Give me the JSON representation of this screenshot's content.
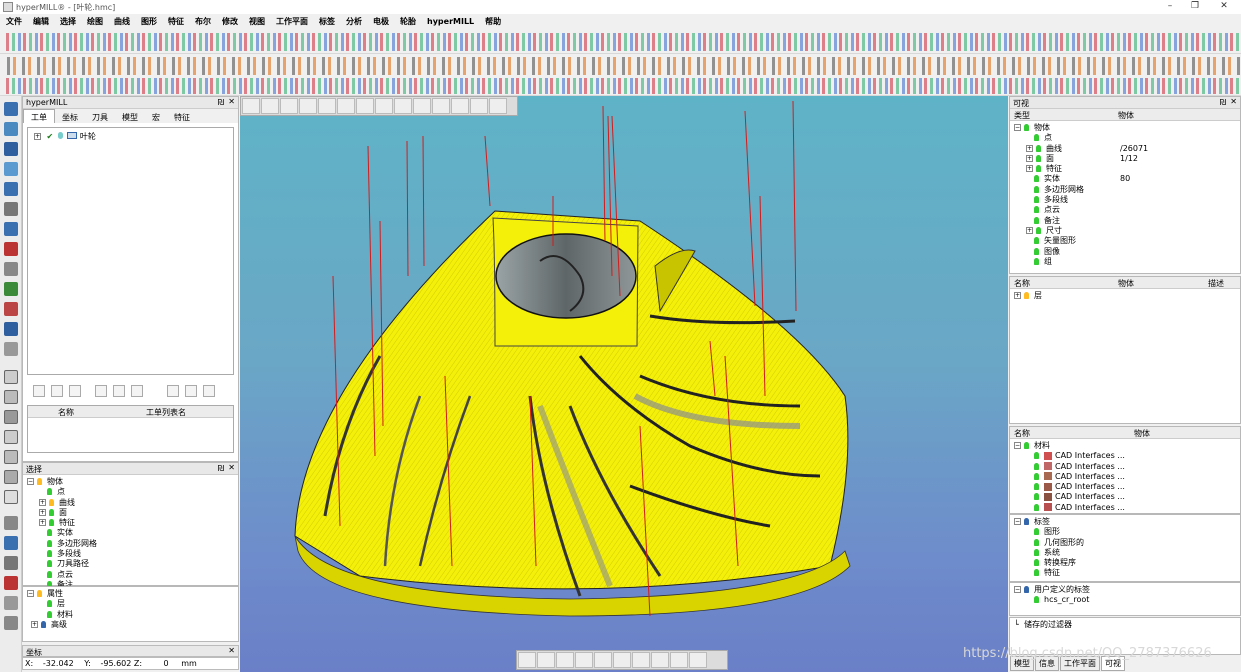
{
  "window": {
    "title": "hyperMILL® - [叶轮.hmc]",
    "min": "–",
    "max": "❐",
    "close": "✕"
  },
  "menu": [
    "文件",
    "编辑",
    "选择",
    "绘图",
    "曲线",
    "图形",
    "特征",
    "布尔",
    "修改",
    "视图",
    "工作平面",
    "标签",
    "分析",
    "电极",
    "轮胎",
    "hyperMILL",
    "帮助"
  ],
  "hypermill_panel": {
    "title": "hyperMILL",
    "pin": "₪",
    "close": "✕",
    "tabs": [
      "工单",
      "坐标",
      "刀具",
      "模型",
      "宏",
      "特征"
    ],
    "active_tab": "工单",
    "tree_root": "叶轮",
    "list_columns": [
      "名称",
      "工单列表名"
    ]
  },
  "select_panel": {
    "title": "选择",
    "items": [
      "物体",
      "点",
      "曲线",
      "面",
      "特征",
      "实体",
      "多边形网格",
      "多段线",
      "刀具路径",
      "点云",
      "备注"
    ]
  },
  "attr_panel": {
    "items": [
      "属性",
      "层",
      "材料",
      "高级"
    ]
  },
  "coords": {
    "title": "坐标",
    "x_label": "X:",
    "x_value": "-32.042",
    "y_label": "Y:",
    "y_value": "-95.602",
    "z_label": "Z:",
    "z_value": "0",
    "unit": "mm"
  },
  "visible_panel": {
    "title": "可视",
    "columns": [
      "类型",
      "物体"
    ],
    "rows": [
      {
        "label": "物体",
        "value": ""
      },
      {
        "label": "点",
        "value": ""
      },
      {
        "label": "曲线",
        "value": "/26071"
      },
      {
        "label": "面",
        "value": "1/12"
      },
      {
        "label": "特征",
        "value": ""
      },
      {
        "label": "实体",
        "value": "80"
      },
      {
        "label": "多边形网格",
        "value": ""
      },
      {
        "label": "多段线",
        "value": ""
      },
      {
        "label": "点云",
        "value": ""
      },
      {
        "label": "备注",
        "value": ""
      },
      {
        "label": "尺寸",
        "value": ""
      },
      {
        "label": "矢量图形",
        "value": ""
      },
      {
        "label": "图像",
        "value": ""
      },
      {
        "label": "组",
        "value": ""
      }
    ]
  },
  "layers_panel": {
    "columns": [
      "名称",
      "物体",
      "描述"
    ],
    "row": "层"
  },
  "materials_panel": {
    "columns": [
      "名称",
      "物体"
    ],
    "root": "材料",
    "items": [
      "CAD Interfaces ...",
      "CAD Interfaces ...",
      "CAD Interfaces ...",
      "CAD Interfaces ...",
      "CAD Interfaces ...",
      "CAD Interfaces ..."
    ],
    "swatches": [
      "#d05050",
      "#c06868",
      "#a86a50",
      "#9b5a48",
      "#8a5240",
      "#b85050"
    ]
  },
  "tags_panel": {
    "root": "标签",
    "items": [
      "图形",
      "几何图形的",
      "系统",
      "转换程序",
      "特征"
    ],
    "user_root": "用户定义的标签",
    "user_items": [
      "hcs_cr_root"
    ],
    "filter": "储存的过滤器"
  },
  "right_tabs": [
    "模型",
    "信息",
    "工作平面",
    "可视"
  ],
  "active_right_tab": "可视",
  "watermark": "https://blog.csdn.net/QQ_2787376626",
  "colors": {
    "impeller_yellow": "#f5f00a",
    "toolpath_red": "#d21c1c",
    "viewport_top": "#5fb3c7",
    "viewport_bottom": "#6a7fc7"
  }
}
